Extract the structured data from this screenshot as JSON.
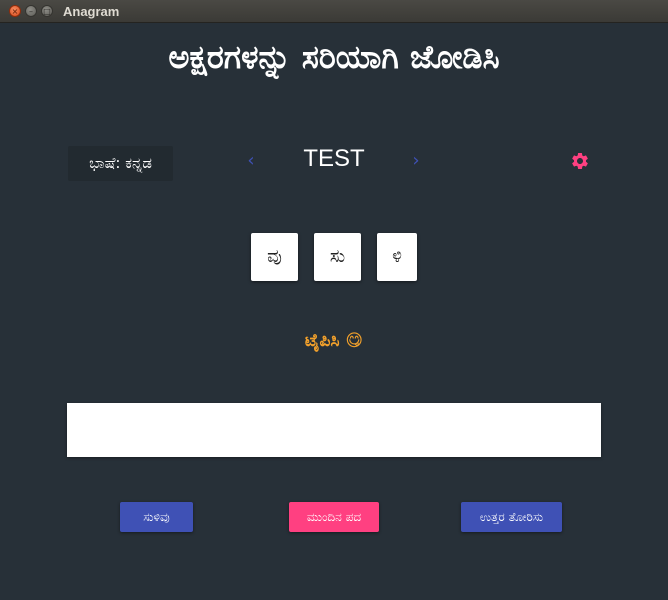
{
  "window": {
    "title": "Anagram",
    "controls": {
      "close": "×",
      "minimize": "–",
      "maximize": "□"
    }
  },
  "page": {
    "heading": "ಅಕ್ಷರಗಳನ್ನು ಸರಿಯಾಗಿ ಜೋಡಿಸಿ",
    "language_label": "ಭಾಷೆ: ಕನ್ನಡ",
    "prev_arrow": "‹",
    "next_arrow": "›",
    "current_word": "TEST",
    "settings_icon": "gear-icon",
    "tiles": [
      "ವು",
      "ಸು",
      "ಳಿ"
    ],
    "hint": "ಟೈಪಿಸಿ 😋",
    "answer_value": "",
    "buttons": {
      "hint": "ಸುಳಿವು",
      "next": "ಮುಂದಿನ ಪದ",
      "show_answer": "ಉತ್ತರ ತೋರಿಸು"
    }
  },
  "colors": {
    "background": "#273038",
    "primary": "#3f51b5",
    "accent": "#ff4081",
    "hint_text": "#f3a12b"
  }
}
